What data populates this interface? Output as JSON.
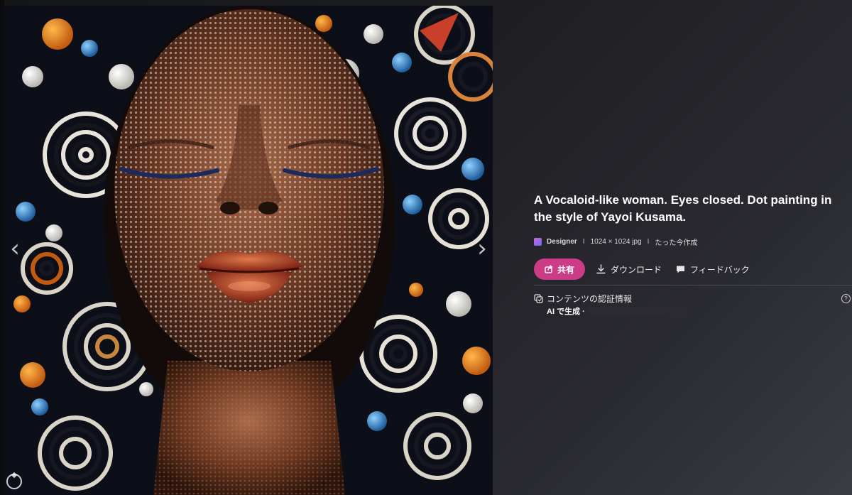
{
  "image": {
    "alt": "A Vocaloid-like woman. Eyes closed. Dot painting in the style of Yayoi Kusama."
  },
  "nav": {
    "prev_glyph": "‹",
    "next_glyph": "›"
  },
  "details": {
    "title": "A Vocaloid-like woman. Eyes closed. Dot painting in the style of Yayoi Kusama.",
    "creator": "Designer",
    "size": "1024 × 1024 jpg",
    "created": "たった今作成",
    "separator": "I"
  },
  "actions": {
    "share_label": "共有",
    "download_label": "ダウンロード",
    "feedback_label": "フィードバック"
  },
  "credentials": {
    "heading": "コンテンツの認証情報",
    "generated": "AI で生成 ·",
    "help": "?"
  },
  "colors": {
    "accent": "#cc3c86",
    "background": "#1c1c1f",
    "divider": "#4a4a52"
  }
}
